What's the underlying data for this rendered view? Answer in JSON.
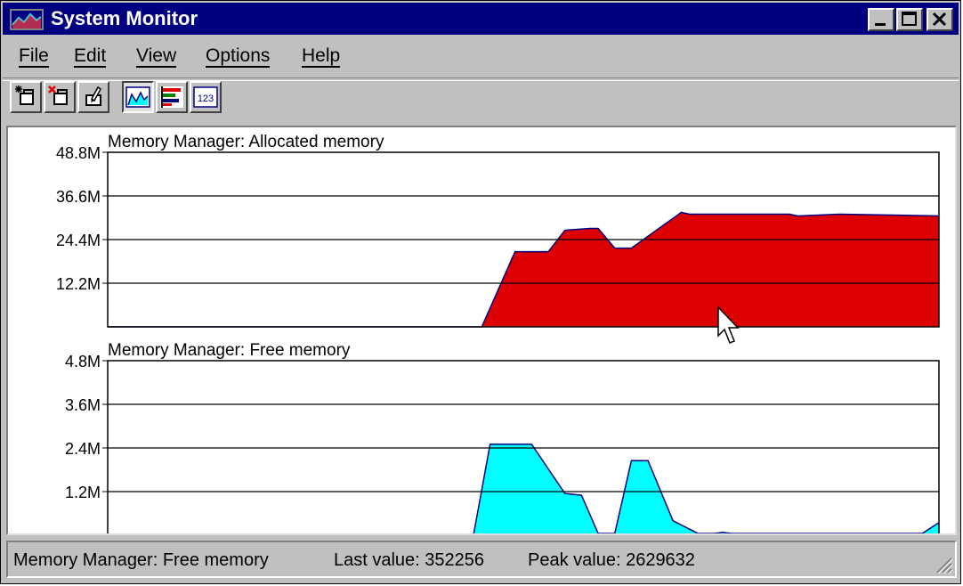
{
  "window": {
    "title": "System Monitor"
  },
  "menu": {
    "items": [
      "File",
      "Edit",
      "View",
      "Options",
      "Help"
    ]
  },
  "toolbar": {
    "buttons": [
      {
        "icon": "add-item-icon"
      },
      {
        "icon": "remove-item-icon"
      },
      {
        "icon": "edit-item-icon"
      },
      {
        "icon": "line-chart-icon",
        "pressed": true
      },
      {
        "icon": "bar-chart-icon"
      },
      {
        "icon": "numeric-view-icon",
        "label": "123"
      }
    ]
  },
  "chart_data": [
    {
      "type": "area",
      "title": "Memory Manager: Allocated memory",
      "yticks": [
        "48.8M",
        "36.6M",
        "24.4M",
        "12.2M"
      ],
      "ylim": [
        0,
        48.8
      ],
      "unit": "M",
      "grid": true,
      "color": "#dd0000",
      "x": [
        0,
        44,
        45,
        49,
        53,
        55,
        58,
        59,
        61,
        63,
        69,
        70,
        72,
        82,
        83,
        88,
        100
      ],
      "values": [
        0,
        0,
        0,
        21,
        21,
        27,
        27.5,
        27.5,
        22,
        22,
        32,
        31.5,
        31.5,
        31.5,
        31,
        31.5,
        31
      ]
    },
    {
      "type": "area",
      "title": "Memory Manager: Free memory",
      "yticks": [
        "4.8M",
        "3.6M",
        "2.4M",
        "1.2M"
      ],
      "ylim": [
        0,
        4.8
      ],
      "unit": "M",
      "grid": true,
      "color": "#00ffff",
      "x": [
        0,
        44,
        46,
        51,
        55,
        57,
        59,
        61,
        63,
        65,
        68,
        71,
        73,
        74,
        75,
        98,
        100
      ],
      "values": [
        0,
        0,
        2.5,
        2.5,
        1.15,
        1.1,
        0.05,
        0.05,
        2.05,
        2.05,
        0.4,
        0.05,
        0.05,
        0.08,
        0.05,
        0.05,
        0.35
      ]
    }
  ],
  "status": {
    "counter": "Memory Manager: Free memory",
    "last_value_label": "Last value: 352256",
    "peak_value_label": "Peak value: 2629632"
  }
}
